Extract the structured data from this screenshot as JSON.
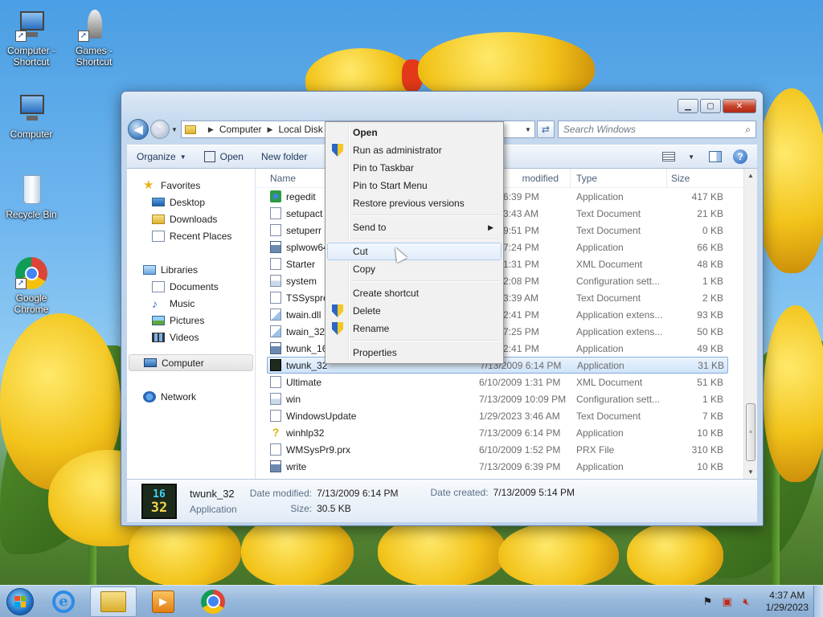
{
  "desktop": {
    "icons": [
      {
        "label": "Computer - Shortcut",
        "icon": "computer-icon"
      },
      {
        "label": "Games - Shortcut",
        "icon": "games-icon"
      },
      {
        "label": "Computer",
        "icon": "computer-icon"
      },
      {
        "label": "Recycle Bin",
        "icon": "recycle-bin-icon"
      },
      {
        "label": "Google Chrome",
        "icon": "chrome-icon"
      }
    ]
  },
  "window": {
    "breadcrumb": [
      "Computer",
      "Local Disk ("
    ],
    "search_placeholder": "Search Windows",
    "toolbar": {
      "organize": "Organize",
      "open": "Open",
      "new_folder": "New folder"
    },
    "nav": {
      "favorites": "Favorites",
      "desktop": "Desktop",
      "downloads": "Downloads",
      "recent": "Recent Places",
      "libraries": "Libraries",
      "documents": "Documents",
      "music": "Music",
      "pictures": "Pictures",
      "videos": "Videos",
      "computer": "Computer",
      "network": "Network"
    },
    "columns": {
      "name": "Name",
      "date": "modified",
      "type": "Type",
      "size": "Size"
    },
    "files": [
      {
        "name": "regedit",
        "date": "2009 6:39 PM",
        "type": "Application",
        "size": "417 KB",
        "icon": "regedit"
      },
      {
        "name": "setupact",
        "date": "2023 3:43 AM",
        "type": "Text Document",
        "size": "21 KB",
        "icon": "doc"
      },
      {
        "name": "setuperr",
        "date": "2009 9:51 PM",
        "type": "Text Document",
        "size": "0 KB",
        "icon": "doc"
      },
      {
        "name": "splwow64",
        "date": "2010 7:24 PM",
        "type": "Application",
        "size": "66 KB",
        "icon": "app"
      },
      {
        "name": "Starter",
        "date": "2009 1:31 PM",
        "type": "XML Document",
        "size": "48 KB",
        "icon": "doc"
      },
      {
        "name": "system",
        "date": "2009 2:08 PM",
        "type": "Configuration sett...",
        "size": "1 KB",
        "icon": "cfg"
      },
      {
        "name": "TSSyspre",
        "date": "2023 3:39 AM",
        "type": "Text Document",
        "size": "2 KB",
        "icon": "doc"
      },
      {
        "name": "twain.dll",
        "date": "2009 2:41 PM",
        "type": "Application extens...",
        "size": "93 KB",
        "icon": "dll"
      },
      {
        "name": "twain_32.",
        "date": "2010 7:25 PM",
        "type": "Application extens...",
        "size": "50 KB",
        "icon": "dll"
      },
      {
        "name": "twunk_16",
        "date": "2009 2:41 PM",
        "type": "Application",
        "size": "49 KB",
        "icon": "app"
      },
      {
        "name": "twunk_32",
        "date": "7/13/2009 6:14 PM",
        "type": "Application",
        "size": "31 KB",
        "icon": "exe32",
        "selected": true
      },
      {
        "name": "Ultimate",
        "date": "6/10/2009 1:31 PM",
        "type": "XML Document",
        "size": "51 KB",
        "icon": "doc"
      },
      {
        "name": "win",
        "date": "7/13/2009 10:09 PM",
        "type": "Configuration sett...",
        "size": "1 KB",
        "icon": "cfg"
      },
      {
        "name": "WindowsUpdate",
        "date": "1/29/2023 3:46 AM",
        "type": "Text Document",
        "size": "7 KB",
        "icon": "doc"
      },
      {
        "name": "winhlp32",
        "date": "7/13/2009 6:14 PM",
        "type": "Application",
        "size": "10 KB",
        "icon": "help"
      },
      {
        "name": "WMSysPr9.prx",
        "date": "6/10/2009 1:52 PM",
        "type": "PRX File",
        "size": "310 KB",
        "icon": "doc"
      },
      {
        "name": "write",
        "date": "7/13/2009 6:39 PM",
        "type": "Application",
        "size": "10 KB",
        "icon": "app"
      }
    ],
    "details": {
      "icon_top": "16",
      "icon_bottom": "32",
      "name": "twunk_32",
      "kind": "Application",
      "modified_label": "Date modified:",
      "modified_value": "7/13/2009 6:14 PM",
      "size_label": "Size:",
      "size_value": "30.5 KB",
      "created_label": "Date created:",
      "created_value": "7/13/2009 5:14 PM"
    }
  },
  "context_menu": {
    "items": [
      {
        "label": "Open",
        "bold": true
      },
      {
        "label": "Run as administrator",
        "shield": true
      },
      {
        "label": "Pin to Taskbar"
      },
      {
        "label": "Pin to Start Menu"
      },
      {
        "label": "Restore previous versions"
      },
      {
        "sep": true
      },
      {
        "label": "Send to",
        "submenu": true
      },
      {
        "sep": true
      },
      {
        "label": "Cut",
        "hover": true
      },
      {
        "label": "Copy"
      },
      {
        "sep": true
      },
      {
        "label": "Create shortcut"
      },
      {
        "label": "Delete",
        "shield": true
      },
      {
        "label": "Rename",
        "shield": true
      },
      {
        "sep": true
      },
      {
        "label": "Properties"
      }
    ]
  },
  "taskbar": {
    "clock_time": "4:37 AM",
    "clock_date": "1/29/2023"
  }
}
